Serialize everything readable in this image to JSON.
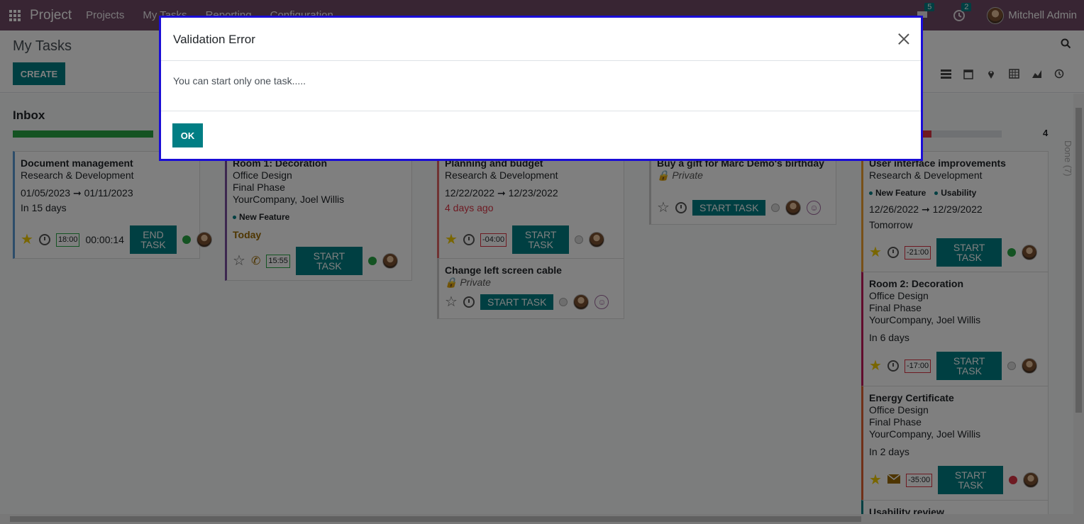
{
  "navbar": {
    "brand": "Project",
    "menu": [
      "Projects",
      "My Tasks",
      "Reporting",
      "Configuration"
    ],
    "messages_count": "5",
    "activities_count": "2",
    "user_name": "Mitchell Admin"
  },
  "control": {
    "title": "My Tasks",
    "create_label": "CREATE"
  },
  "kanban": {
    "inbox_title": "Inbox",
    "done_count": "4",
    "done_label": "Done (7)",
    "cards": [
      {
        "title": "Document management",
        "line1": "Research & Development",
        "dates": "01/05/2023 ➞ 01/11/2023",
        "deadline": "In 15 days",
        "timer": "18:00",
        "elapsed": "00:00:14",
        "button": "END TASK"
      },
      {
        "title": "Room 1: Decoration",
        "line1": "Office Design",
        "line2": "Final Phase",
        "line3": "YourCompany, Joel Willis",
        "tag": "New Feature",
        "deadline": "Today",
        "timer": "15:55",
        "button": "START TASK"
      },
      {
        "title": "Planning and budget",
        "line1": "Research & Development",
        "dates": "12/22/2022 ➞ 12/23/2022",
        "deadline": "4 days ago",
        "timer": "-04:00",
        "button": "START TASK"
      },
      {
        "title": "Change left screen cable",
        "private": "Private",
        "button": "START TASK"
      },
      {
        "title": "Buy a gift for Marc Demo's birthday",
        "private": "Private",
        "button": "START TASK"
      },
      {
        "title": "User interface improvements",
        "line1": "Research & Development",
        "tag1": "New Feature",
        "tag2": "Usability",
        "dates": "12/26/2022 ➞ 12/29/2022",
        "deadline": "Tomorrow",
        "timer": "-21:00",
        "button": "START TASK"
      },
      {
        "title": "Room 2: Decoration",
        "line1": "Office Design",
        "line2": "Final Phase",
        "line3": "YourCompany, Joel Willis",
        "deadline": "In 6 days",
        "timer": "-17:00",
        "button": "START TASK"
      },
      {
        "title": "Energy Certificate",
        "line1": "Office Design",
        "line2": "Final Phase",
        "line3": "YourCompany, Joel Willis",
        "deadline": "In 2 days",
        "timer": "-35:00",
        "button": "START TASK"
      },
      {
        "title": "Usability review"
      }
    ]
  },
  "modal": {
    "title": "Validation Error",
    "message": "You can start only one task.....",
    "ok_label": "OK"
  }
}
